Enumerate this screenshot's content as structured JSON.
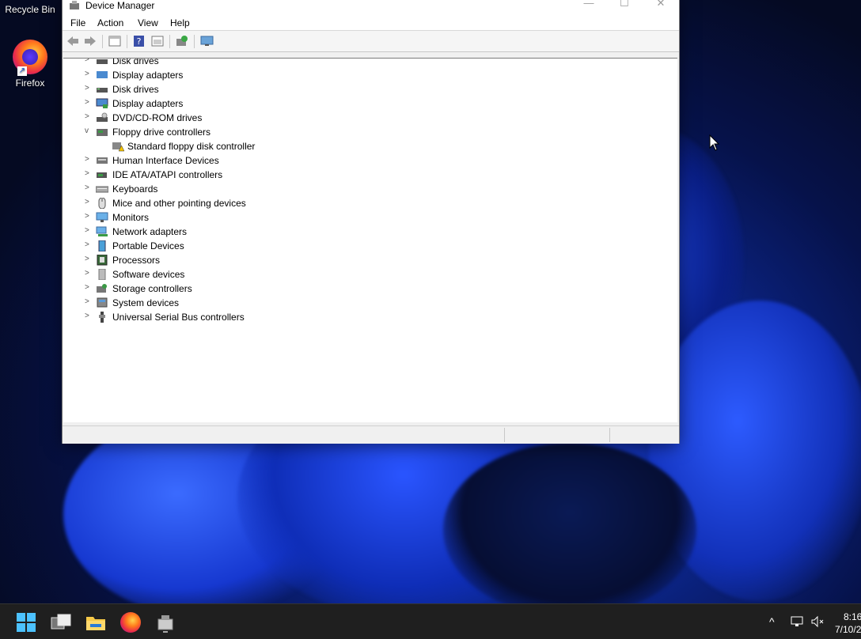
{
  "desktop": {
    "recycle_bin_label": "Recycle Bin",
    "firefox_label": "Firefox"
  },
  "window": {
    "title": "Device Manager",
    "controls": {
      "minimize": "—",
      "maximize": "☐",
      "close": "✕"
    }
  },
  "menu": [
    "File",
    "Action",
    "View",
    "Help"
  ],
  "toolbar": [
    "back-icon",
    "forward-icon",
    "properties-icon",
    "help-icon",
    "show-hidden-icon",
    "update-driver-icon",
    "scan-hardware-icon"
  ],
  "tree": {
    "partial_rows": [
      "Disk drives",
      "Display adapters"
    ],
    "rows": [
      {
        "label": "Disk drives",
        "icon": "disk-drive-icon",
        "expanded": false
      },
      {
        "label": "Display adapters",
        "icon": "display-adapter-icon",
        "expanded": false
      },
      {
        "label": "DVD/CD-ROM drives",
        "icon": "dvd-drive-icon",
        "expanded": false
      },
      {
        "label": "Floppy drive controllers",
        "icon": "floppy-controller-icon",
        "expanded": true
      },
      {
        "label": "Standard floppy disk controller",
        "icon": "warning-device-icon",
        "child": true
      },
      {
        "label": "Human Interface Devices",
        "icon": "hid-icon",
        "expanded": false
      },
      {
        "label": "IDE ATA/ATAPI controllers",
        "icon": "ide-controller-icon",
        "expanded": false
      },
      {
        "label": "Keyboards",
        "icon": "keyboard-icon",
        "expanded": false
      },
      {
        "label": "Mice and other pointing devices",
        "icon": "mouse-icon",
        "expanded": false
      },
      {
        "label": "Monitors",
        "icon": "monitor-icon",
        "expanded": false
      },
      {
        "label": "Network adapters",
        "icon": "network-adapter-icon",
        "expanded": false
      },
      {
        "label": "Portable Devices",
        "icon": "portable-device-icon",
        "expanded": false
      },
      {
        "label": "Processors",
        "icon": "processor-icon",
        "expanded": false
      },
      {
        "label": "Software devices",
        "icon": "software-device-icon",
        "expanded": false
      },
      {
        "label": "Storage controllers",
        "icon": "storage-controller-icon",
        "expanded": false
      },
      {
        "label": "System devices",
        "icon": "system-device-icon",
        "expanded": false
      },
      {
        "label": "Universal Serial Bus controllers",
        "icon": "usb-icon",
        "expanded": false
      }
    ]
  },
  "taskbar": {
    "items": [
      "start-icon",
      "task-view-icon",
      "file-explorer-icon",
      "firefox-icon",
      "device-manager-icon"
    ],
    "clock_time": "8:16",
    "clock_date": "7/10/2"
  },
  "colors": {
    "accent": "#1a5ad6",
    "taskbar": "#1f1f1f",
    "window_bg": "#f0f0f0"
  }
}
